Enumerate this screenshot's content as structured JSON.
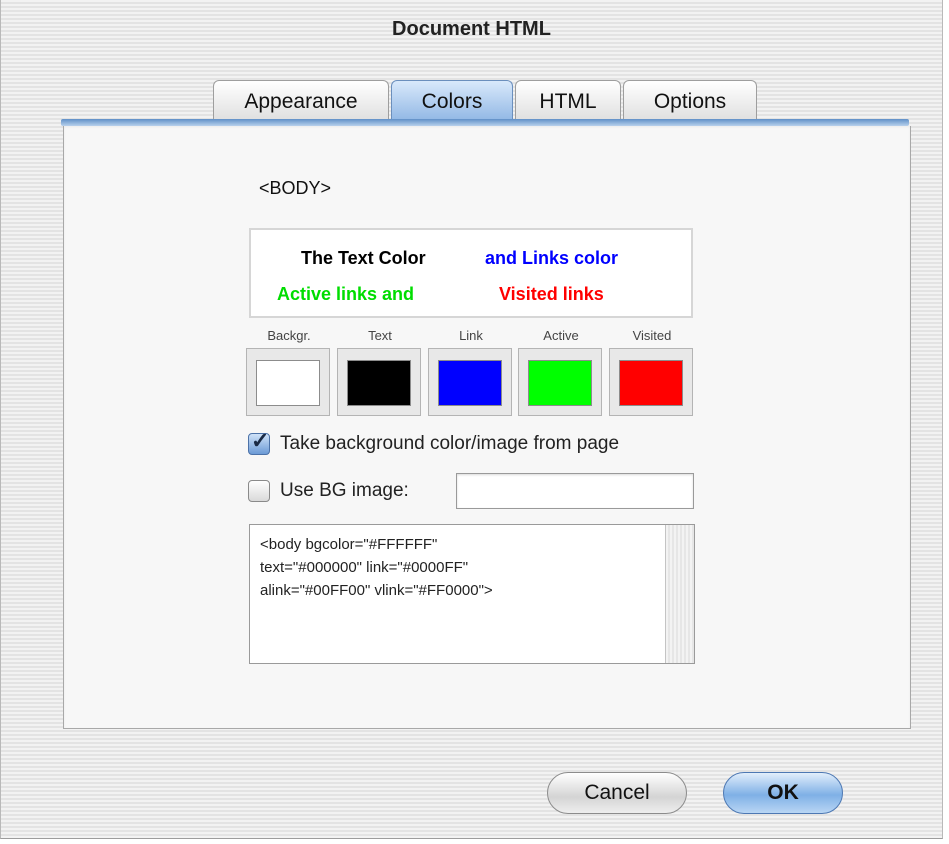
{
  "window": {
    "title": "Document HTML"
  },
  "tabs": [
    {
      "label": "Appearance",
      "selected": false
    },
    {
      "label": "Colors",
      "selected": true
    },
    {
      "label": "HTML",
      "selected": false
    },
    {
      "label": "Options",
      "selected": false
    }
  ],
  "colors_panel": {
    "body_tag": "<BODY>",
    "preview": {
      "text_sample": "The Text Color",
      "link_sample": "and Links color",
      "active_sample": "Active links and",
      "visited_sample": "Visited links"
    },
    "swatches": [
      {
        "label": "Backgr.",
        "color": "#FFFFFF"
      },
      {
        "label": "Text",
        "color": "#000000"
      },
      {
        "label": "Link",
        "color": "#0000FF"
      },
      {
        "label": "Active",
        "color": "#00FF00"
      },
      {
        "label": "Visited",
        "color": "#FF0000"
      }
    ],
    "take_from_page": {
      "label": "Take background color/image from page",
      "checked": true
    },
    "use_bg_image": {
      "label": "Use BG image:",
      "checked": false,
      "value": ""
    },
    "code": "<body bgcolor=\"#FFFFFF\"\ntext=\"#000000\" link=\"#0000FF\"\nalink=\"#00FF00\" vlink=\"#FF0000\">"
  },
  "buttons": {
    "cancel": "Cancel",
    "ok": "OK"
  }
}
